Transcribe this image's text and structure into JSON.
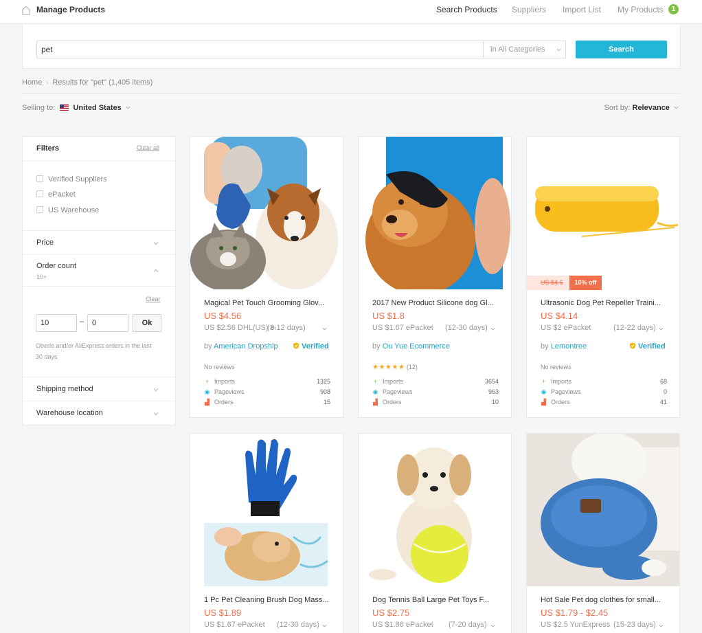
{
  "nav": {
    "title": "Manage Products",
    "items": [
      {
        "label": "Search Products"
      },
      {
        "label": "Suppliers"
      },
      {
        "label": "Import List"
      },
      {
        "label": "My Products"
      }
    ],
    "my_products_count": "1"
  },
  "search": {
    "query": "pet",
    "category": "in All Categories",
    "button": "Search"
  },
  "breadcrumb": {
    "home": "Home",
    "results": "Results for \"pet\" (1,405 items)"
  },
  "selling": {
    "label": "Selling to:",
    "country": "United States"
  },
  "sort": {
    "label": "Sort by:",
    "value": "Relevance"
  },
  "filters": {
    "title": "Filters",
    "clear_all": "Clear all",
    "checkboxes": [
      "Verified Suppliers",
      "ePacket",
      "US Warehouse"
    ],
    "price": "Price",
    "order_count": "Order count",
    "order_count_sub": "10+",
    "clear": "Clear",
    "min": "10",
    "dash": "–",
    "max": "0",
    "ok": "Ok",
    "note": "Oberlo and/or AliExpress orders in the last 30 days",
    "shipping": "Shipping method",
    "warehouse": "Warehouse location"
  },
  "products": [
    {
      "title": "Magical Pet Touch Grooming Glov...",
      "price": "US $4.56",
      "shipping": "US $2.56 DHL(US) e...",
      "days": "(3-12 days)",
      "seller_prefix": "by",
      "seller": "American Dropship",
      "verified": "Verified",
      "reviews": "No reviews",
      "imports_label": "Imports",
      "imports": "1325",
      "pageviews_label": "Pageviews",
      "pageviews": "908",
      "orders_label": "Orders",
      "orders": "15"
    },
    {
      "title": "2017 New Product Silicone dog Gl...",
      "price": "US $1.8",
      "shipping": "US $1.67 ePacket",
      "days": "(12-30 days)",
      "seller_prefix": "by",
      "seller": "Ou Yue Ecommerce",
      "stars": "★★★★★",
      "review_count": "(12)",
      "rating": 5,
      "imports_label": "Imports",
      "imports": "3654",
      "pageviews_label": "Pageviews",
      "pageviews": "963",
      "orders_label": "Orders",
      "orders": "10"
    },
    {
      "title": "Ultrasonic Dog Pet Repeller Traini...",
      "price": "US $4.14",
      "old_price": "US $4.6",
      "discount": "10% off",
      "shipping": "US $2 ePacket",
      "days": "(12-22 days)",
      "seller_prefix": "by",
      "seller": "Lemontree",
      "verified": "Verified",
      "reviews": "No reviews",
      "imports_label": "Imports",
      "imports": "68",
      "pageviews_label": "Pageviews",
      "pageviews": "0",
      "orders_label": "Orders",
      "orders": "41"
    },
    {
      "title": "1 Pc Pet Cleaning Brush Dog Mass...",
      "price": "US $1.89",
      "shipping": "US $1.67 ePacket",
      "days": "(12-30 days)"
    },
    {
      "title": "Dog Tennis Ball Large Pet Toys F...",
      "price": "US $2.75",
      "shipping": "US $1.86 ePacket",
      "days": "(7-20 days)"
    },
    {
      "title": "Hot Sale Pet dog clothes for small...",
      "price": "US $1.79 - $2.45",
      "shipping": "US $2.5 YunExpress",
      "days": "(15-23 days)"
    }
  ],
  "colors": {
    "accent": "#25b5d7",
    "price": "#f0704b",
    "verified": "#25a5c8",
    "badge": "#7dc243"
  }
}
